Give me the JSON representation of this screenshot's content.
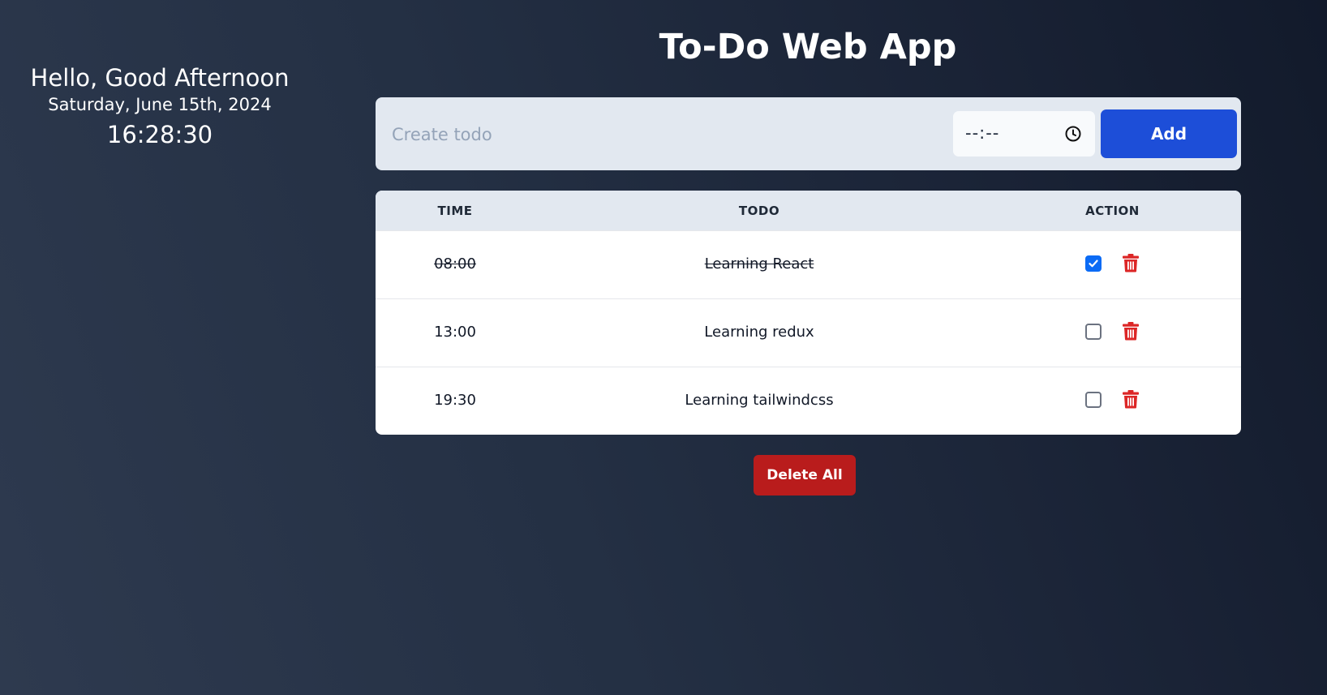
{
  "app": {
    "title": "To-Do Web App"
  },
  "greeting": {
    "message": "Hello, Good Afternoon",
    "date": "Saturday, June 15th, 2024",
    "time": "16:28:30"
  },
  "form": {
    "todo_placeholder": "Create todo",
    "todo_value": "",
    "time_value": "--:--",
    "time_icon": "clock-icon",
    "add_label": "Add"
  },
  "table": {
    "headers": {
      "time": "TIME",
      "todo": "TODO",
      "action": "ACTION"
    },
    "rows": [
      {
        "time": "08:00",
        "todo": "Learning React",
        "done": true
      },
      {
        "time": "13:00",
        "todo": "Learning redux",
        "done": false
      },
      {
        "time": "19:30",
        "todo": "Learning tailwindcss",
        "done": false
      }
    ]
  },
  "delete_all_label": "Delete All",
  "colors": {
    "accent": "#1d4ed8",
    "danger": "#b91c1c",
    "trash": "#dc2626",
    "checkbox_checked": "#0b6bf5"
  }
}
